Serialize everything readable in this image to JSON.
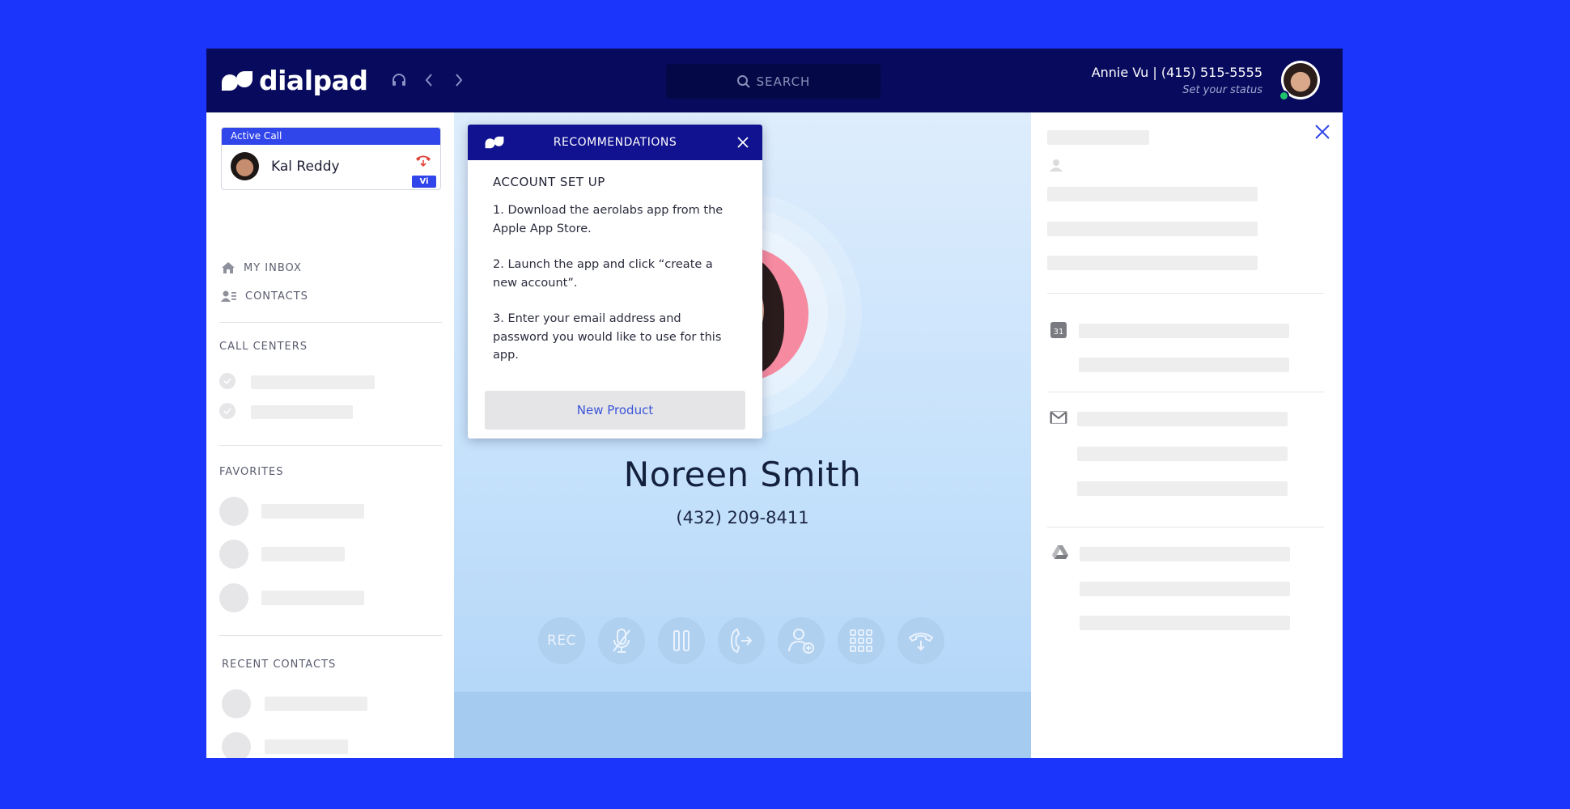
{
  "brand": {
    "name": "dialpad"
  },
  "search": {
    "label": "SEARCH"
  },
  "user": {
    "name": "Annie Vu | (415) 515-5555",
    "status": "Set your status"
  },
  "active_call": {
    "header": "Active Call",
    "name": "Kal Reddy",
    "badge": "Vi"
  },
  "sidebar": {
    "links": [
      {
        "label": "MY INBOX",
        "icon": "home-icon"
      },
      {
        "label": "CONTACTS",
        "icon": "contacts-icon"
      }
    ],
    "sections": {
      "call_centers": "CALL CENTERS",
      "favorites": "FAVORITES",
      "recent_contacts": "RECENT CONTACTS"
    }
  },
  "call": {
    "name": "Noreen Smith",
    "number": "(432) 209-8411"
  },
  "controls": [
    {
      "id": "record",
      "label": "REC",
      "icon": "record-icon"
    },
    {
      "id": "mute",
      "icon": "microphone-off-icon"
    },
    {
      "id": "hold",
      "icon": "pause-icon"
    },
    {
      "id": "transfer",
      "icon": "transfer-call-icon"
    },
    {
      "id": "add-person",
      "icon": "add-person-icon"
    },
    {
      "id": "keypad",
      "icon": "keypad-icon"
    },
    {
      "id": "hangup",
      "icon": "hang-up-icon"
    }
  ],
  "popup": {
    "title": "RECOMMENDATIONS",
    "heading": "ACCOUNT SET UP",
    "steps": [
      "1. Download the aerolabs app from the\n Apple App Store.",
      "2. Launch the app and click “create a new account”.",
      "3. Enter your email address and password you would like to use for this app."
    ],
    "button": "New Product"
  },
  "right_panel": {
    "icons": [
      "person-icon",
      "calendar-icon",
      "gmail-icon",
      "google-drive-icon"
    ],
    "calendar_day": "31"
  },
  "colors": {
    "background": "#1c35fb",
    "topbar": "#070a5d",
    "accent": "#3045ea",
    "popup_header": "#11128f",
    "online": "#1ec26d"
  }
}
